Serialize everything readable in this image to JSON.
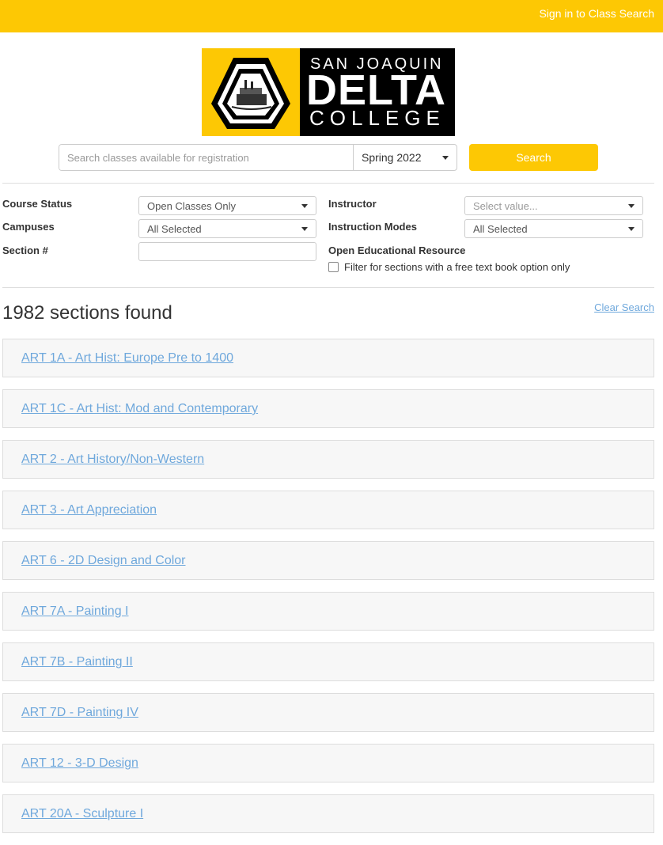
{
  "header": {
    "signin_label": "Sign in to Class Search",
    "brand_color": "#fdc804"
  },
  "logo": {
    "line1": "SAN JOAQUIN",
    "line2": "DELTA",
    "line3": "COLLEGE"
  },
  "search": {
    "placeholder": "Search classes available for registration",
    "value": "",
    "term_selected": "Spring 2022",
    "button_label": "Search"
  },
  "filters": {
    "course_status": {
      "label": "Course Status",
      "value": "Open Classes Only"
    },
    "campuses": {
      "label": "Campuses",
      "value": "All Selected"
    },
    "section": {
      "label": "Section #",
      "value": ""
    },
    "instructor": {
      "label": "Instructor",
      "placeholder": "Select value..."
    },
    "instruction_modes": {
      "label": "Instruction Modes",
      "value": "All Selected"
    },
    "oer": {
      "label": "Open Educational Resource",
      "checkbox_label": "Filter for sections with a free text book option only",
      "checked": false
    }
  },
  "results": {
    "count_text": "1982 sections found",
    "clear_label": "Clear Search",
    "link_color": "#6fa8dc",
    "items": [
      {
        "label": "ART 1A - Art Hist: Europe Pre to 1400"
      },
      {
        "label": "ART 1C - Art Hist: Mod and Contemporary"
      },
      {
        "label": "ART 2 - Art History/Non-Western"
      },
      {
        "label": "ART 3 - Art Appreciation"
      },
      {
        "label": "ART 6 - 2D Design and Color"
      },
      {
        "label": "ART 7A - Painting I"
      },
      {
        "label": "ART 7B - Painting II"
      },
      {
        "label": "ART 7D - Painting IV"
      },
      {
        "label": "ART 12 - 3-D Design"
      },
      {
        "label": "ART 20A - Sculpture I"
      }
    ]
  }
}
